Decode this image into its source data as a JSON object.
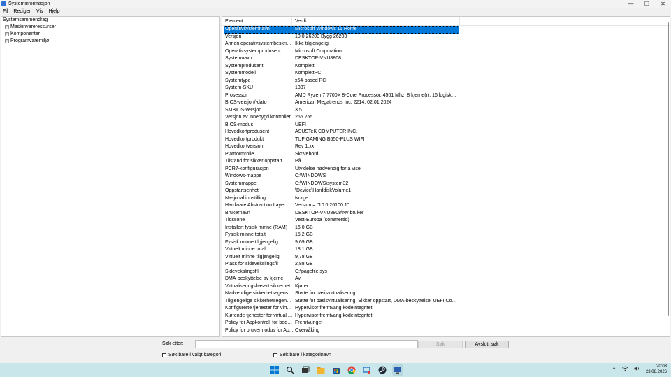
{
  "window": {
    "title": "Systeminformasjon",
    "controls": {
      "minimize": "—",
      "maximize": "☐",
      "close": "✕"
    }
  },
  "menu": [
    "Fil",
    "Rediger",
    "Vis",
    "Hjelp"
  ],
  "tree": {
    "root": "Systemsammendrag",
    "children": [
      "Maskinvareressurser",
      "Komponenter",
      "Programvaremiljø"
    ]
  },
  "details": {
    "headers": {
      "element": "Element",
      "value": "Verdi"
    },
    "rows": [
      [
        "Operativsystemnavn",
        "Microsoft Windows 11 Home"
      ],
      [
        "Versjon",
        "10.0.26200 Bygg 26200"
      ],
      [
        "Annen operativsystembeskrivel...",
        "Ikke tilgjengelig"
      ],
      [
        "Operativsystemprodusent",
        "Microsoft Corporation"
      ],
      [
        "Systemnavn",
        "DESKTOP-VNU8808"
      ],
      [
        "Systemprodusent",
        "Komplett"
      ],
      [
        "Systemmodell",
        "KomplettPC"
      ],
      [
        "Systemtype",
        "x64-based PC"
      ],
      [
        "System-SKU",
        "1337"
      ],
      [
        "Prosessor",
        "AMD Ryzen 7 7700X 8-Core Processor, 4501 Mhz, 8 kjerne(r), 16 logiske pros..."
      ],
      [
        "BIOS-versjon/-dato",
        "American Megatrends Inc. 2214, 02.01.2024"
      ],
      [
        "SMBIOS-versjon",
        "3.5"
      ],
      [
        "Versjon av innebygd kontroller",
        "255.255"
      ],
      [
        "BIOS-modus",
        "UEFI"
      ],
      [
        "Hovedkortprodusent",
        "ASUSTeK COMPUTER INC."
      ],
      [
        "Hovedkortprodukt",
        "TUF GAMING B650-PLUS WIFI"
      ],
      [
        "Hovedkortversjon",
        "Rev 1.xx"
      ],
      [
        "Plattformrolle",
        "Skrivebord"
      ],
      [
        "Tilstand for sikker oppstart",
        "På"
      ],
      [
        "PCR7-konfigurasjon",
        "Utvidelse nødvendig for å vise"
      ],
      [
        "Windows-mappe",
        "C:\\WINDOWS"
      ],
      [
        "Systemmappe",
        "C:\\WINDOWS\\system32"
      ],
      [
        "Oppstartsenhet",
        "\\Device\\HarddiskVolume1"
      ],
      [
        "Nasjonal innstilling",
        "Norge"
      ],
      [
        "Hardware Abstraction Layer",
        "Versjon = \"10.0.26100.1\""
      ],
      [
        "Brukernavn",
        "DESKTOP-VNU8808\\Ny bruker"
      ],
      [
        "Tidssone",
        "Vest-Europa (sommertid)"
      ],
      [
        "Installert fysisk minne (RAM)",
        "16,0 GB"
      ],
      [
        "Fysisk minne totalt",
        "15,2 GB"
      ],
      [
        "Fysisk minne tilgjengelig",
        "9,69 GB"
      ],
      [
        "Virtuelt minne totalt",
        "18,1 GB"
      ],
      [
        "Virtuelt minne tilgjengelig",
        "9,78 GB"
      ],
      [
        "Plass for sidevekslingsfil",
        "2,88 GB"
      ],
      [
        "Sidevekslingsfil",
        "C:\\pagefile.sys"
      ],
      [
        "DMA-beskyttelse av kjerne",
        "Av"
      ],
      [
        "Virtualiseringsbasert sikkerhet",
        "Kjører"
      ],
      [
        "Nødvendige sikkerhetsegenska...",
        "Støtte for basisvirtualisering"
      ],
      [
        "Tilgjengelige sikkerhetsegenska...",
        "Støtte for basisvirtualisering, Sikker oppstart, DMA-beskyttelse, UEFI Code Re..."
      ],
      [
        "Konfigurerte tjenester for virtu...",
        "Hypervisor fremtvang kodeintegritet"
      ],
      [
        "Kjørende tjenester for virtualise...",
        "Hypervisor fremtvang kodeintegritet"
      ],
      [
        "Policy for Appkontroll for bedri...",
        "Fremtvunget"
      ],
      [
        "Policy for brukermodus for Ap...",
        "Overvåking"
      ]
    ]
  },
  "search": {
    "label": "Søk etter:",
    "input_value": "",
    "find_label": "Søk",
    "close_find_label": "Avslutt søk",
    "check_selected_category": "Søk bare i valgt kategori",
    "check_category_names": "Søk bare i kategorinavn"
  },
  "taskbar": {
    "icons": [
      "windows-start-icon",
      "search-icon",
      "task-view-icon",
      "file-explorer-icon",
      "store-icon",
      "chrome-icon",
      "snipping-tool-icon",
      "steam-icon",
      "system-information-icon"
    ],
    "time": "20:03",
    "date": "23.08.2026"
  },
  "colors": {
    "selection": "#0078d7",
    "taskbar": "#c9e6ea"
  }
}
